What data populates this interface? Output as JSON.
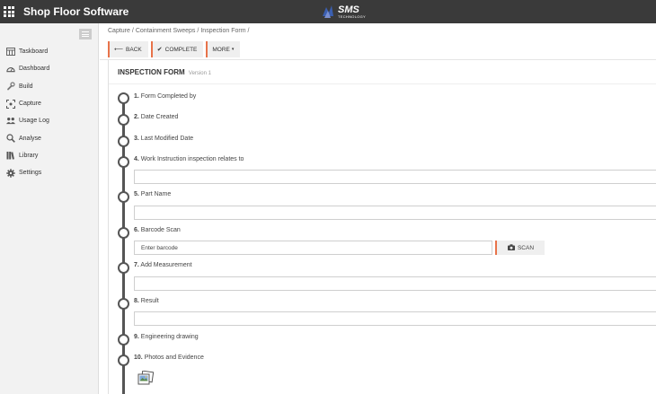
{
  "app": {
    "title": "Shop Floor Software"
  },
  "logo": {
    "main": "SMS",
    "sub": "TECHNOLOGY"
  },
  "sidebar": {
    "items": [
      {
        "label": "Taskboard",
        "icon": "taskboard-icon"
      },
      {
        "label": "Dashboard",
        "icon": "dashboard-icon"
      },
      {
        "label": "Build",
        "icon": "wrench-icon"
      },
      {
        "label": "Capture",
        "icon": "capture-icon"
      },
      {
        "label": "Usage Log",
        "icon": "users-icon"
      },
      {
        "label": "Analyse",
        "icon": "magnifier-icon"
      },
      {
        "label": "Library",
        "icon": "library-icon"
      },
      {
        "label": "Settings",
        "icon": "gear-icon"
      }
    ]
  },
  "breadcrumb": [
    "Capture",
    "Containment Sweeps",
    "Inspection Form"
  ],
  "toolbar": {
    "back": "BACK",
    "complete": "COMPLETE",
    "more": "MORE"
  },
  "form": {
    "title": "INSPECTION FORM",
    "version": "Version 1",
    "steps": [
      {
        "num": "1.",
        "label": "Form Completed by"
      },
      {
        "num": "2.",
        "label": "Date Created"
      },
      {
        "num": "3.",
        "label": "Last Modified Date"
      },
      {
        "num": "4.",
        "label": "Work Instruction inspection relates to"
      },
      {
        "num": "5.",
        "label": "Part Name"
      },
      {
        "num": "6.",
        "label": "Barcode Scan"
      },
      {
        "num": "7.",
        "label": "Add Measurement"
      },
      {
        "num": "8.",
        "label": "Result"
      },
      {
        "num": "9.",
        "label": "Engineering drawing"
      },
      {
        "num": "10.",
        "label": "Photos and Evidence"
      }
    ],
    "barcode_placeholder": "Enter barcode",
    "scan_label": "SCAN"
  },
  "colors": {
    "accent": "#e8734a",
    "topbar": "#3a3a3a",
    "sidebar": "#f2f2f2",
    "timeline": "#555555"
  }
}
